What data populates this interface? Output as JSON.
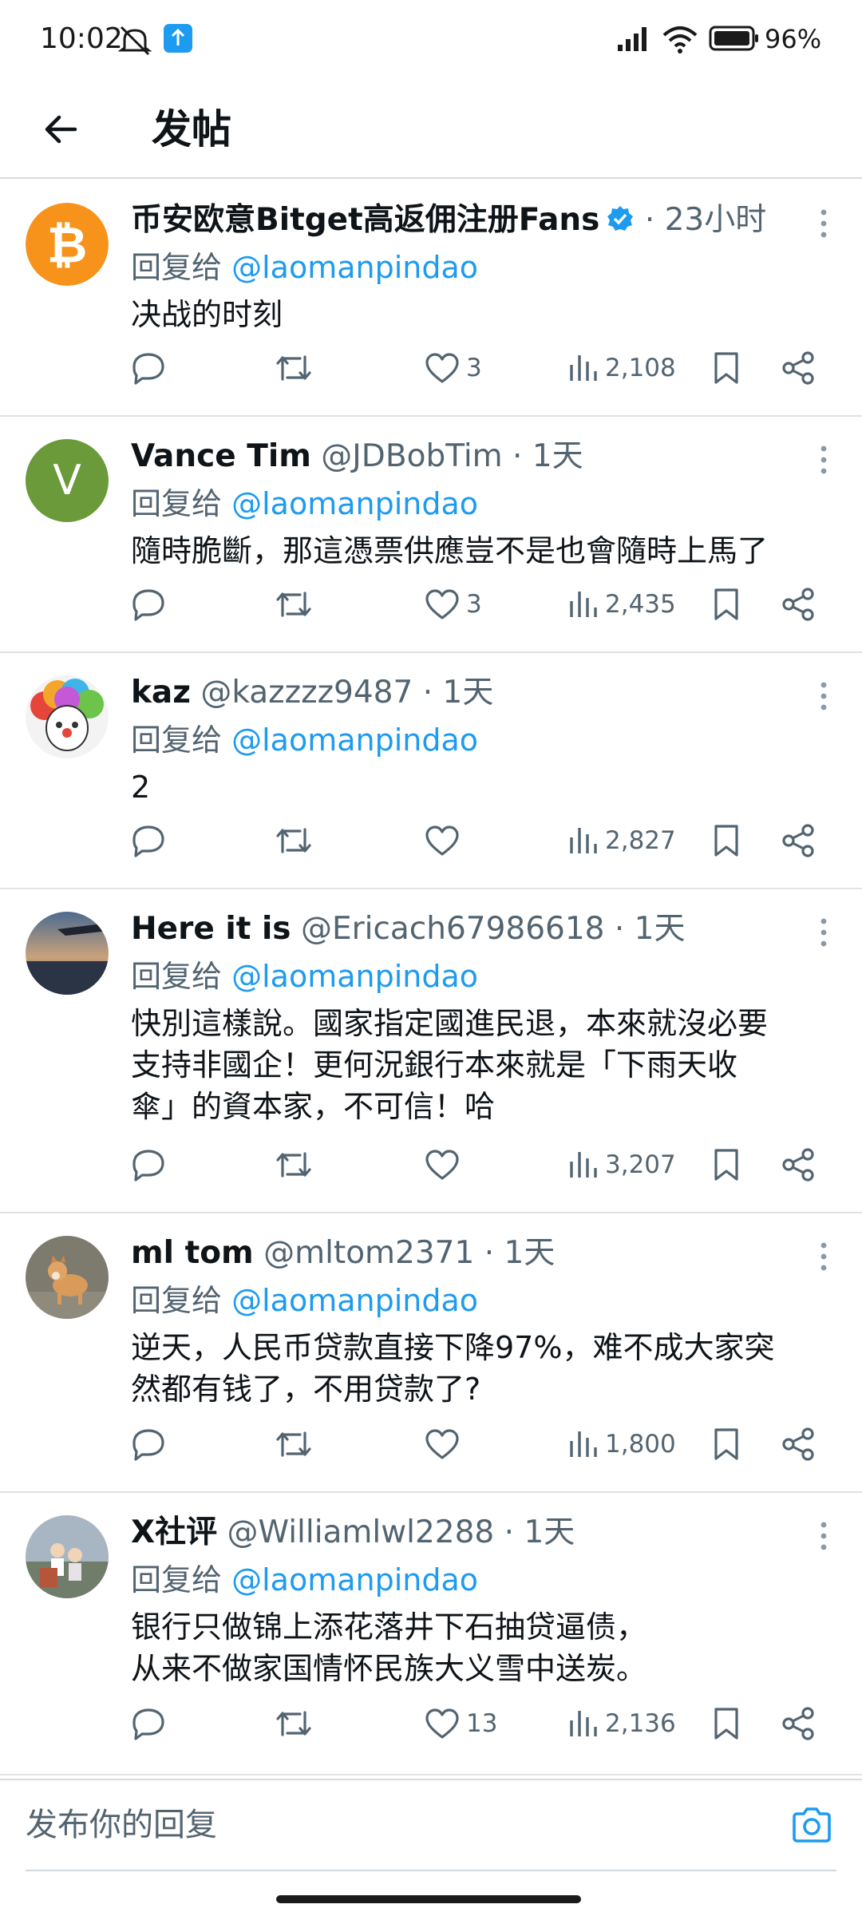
{
  "status_bar": {
    "time": "10:02",
    "battery": "96%"
  },
  "header": {
    "title": "发帖"
  },
  "reply_prefix": "回复给",
  "posts": [
    {
      "username": "币安欧意Bitget高返佣注册Fans",
      "handle": "",
      "time": "23小时",
      "reply_to": "@laomanpindao",
      "text": "决战的时刻",
      "likes": "3",
      "views": "2,108",
      "verified": true,
      "avatar": "bitcoin"
    },
    {
      "username": "Vance Tim",
      "handle": "@JDBobTim",
      "time": "1天",
      "reply_to": "@laomanpindao",
      "text": "隨時脆斷，那這憑票供應豈不是也會隨時上馬了",
      "likes": "3",
      "views": "2,435",
      "avatar_letter": "V",
      "avatar_color": "#6a9a3a"
    },
    {
      "username": "kaz",
      "handle": "@kazzzz9487",
      "time": "1天",
      "reply_to": "@laomanpindao",
      "text": "2",
      "likes": "",
      "views": "2,827",
      "avatar": "clown"
    },
    {
      "username": "Here it is",
      "handle": "@Ericach67986618",
      "time": "1天",
      "reply_to": "@laomanpindao",
      "text_lines": [
        "快別這樣說。國家指定國進民退，本來就沒必要",
        "支持非國企！更何況銀行本來就是「下雨天收",
        "傘」的資本家，不可信！哈"
      ],
      "likes": "",
      "views": "3,207",
      "avatar": "sunset"
    },
    {
      "username": "ml tom",
      "handle": "@mltom2371",
      "time": "1天",
      "reply_to": "@laomanpindao",
      "text_lines": [
        "逆天，人民币贷款直接下降97%，难不成大家突",
        "然都有钱了，不用贷款了?"
      ],
      "likes": "",
      "views": "1,800",
      "avatar": "dog"
    },
    {
      "username": "X社评",
      "handle": "@Williamlwl2288",
      "time": "1天",
      "reply_to": "@laomanpindao",
      "text_lines": [
        "银行只做锦上添花落井下石抽贷逼债，",
        "从来不做家国情怀民族大义雪中送炭。"
      ],
      "likes": "13",
      "views": "2,136",
      "avatar": "people"
    }
  ],
  "compose": {
    "placeholder": "发布你的回复"
  },
  "colors": {
    "accent": "#1d9bf0",
    "muted": "#536471",
    "text": "#0f1419",
    "divider": "#dfe3e6"
  },
  "icons": [
    "back-arrow-icon",
    "reply-icon",
    "repost-icon",
    "heart-icon",
    "views-icon",
    "bookmark-icon",
    "share-icon",
    "more-icon",
    "camera-icon",
    "verified-icon"
  ]
}
